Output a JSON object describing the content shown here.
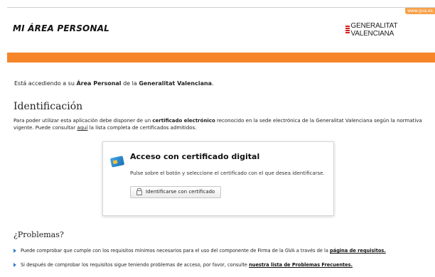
{
  "header": {
    "url_badge": "www.gva.es",
    "app_title": "MI ÁREA PERSONAL",
    "logo_text": "GENERALITAT VALENCIANA"
  },
  "intro": {
    "prefix": "Está accediendo a su ",
    "bold1": "Área Personal",
    "middle": " de la ",
    "bold2": "Generalitat Valenciana",
    "suffix": "."
  },
  "identificacion": {
    "heading": "Identificación",
    "text_part1": "Para poder utilizar esta aplicación debe disponer de un ",
    "text_bold": "certificado electrónico",
    "text_part2": " reconocido en la sede electrónica de la Generalitat Valenciana según la normativa vigente. Puede consultar ",
    "link_aqui": "aquí",
    "text_part3": " la lista completa de certificados admitidos."
  },
  "cert_box": {
    "title": "Acceso con certificado digital",
    "description": "Pulse sobre el botón y seleccione el certificado con el que desea identificarse.",
    "button_label": "Identificarse con certificado"
  },
  "problemas": {
    "heading": "¿Problemas?",
    "item1_text": "Puede comprobar que cumple con los requisitos mínimos necesarios para el uso del componente de Firma de la GVA a través de la ",
    "item1_link": "página de requisitos.",
    "item2_text": "Si después de comprobar los requisitos sigue teniendo problemas de acceso, por favor, consulte ",
    "item2_link": "nuestra lista de Problemas Frecuentes."
  },
  "colors": {
    "accent_orange": "#f6852a",
    "link_bullet": "#3a7cc4"
  }
}
